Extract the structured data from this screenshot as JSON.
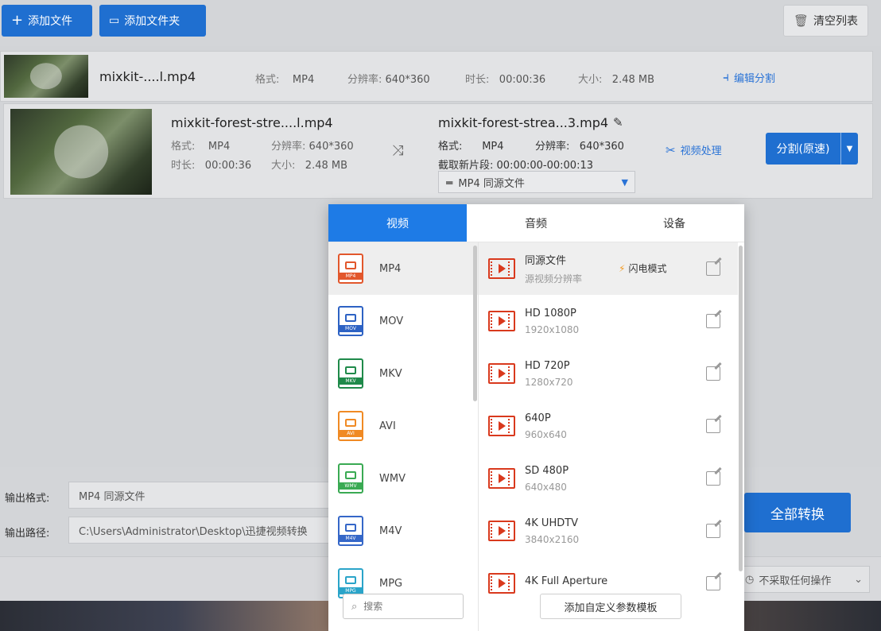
{
  "toolbar": {
    "add_file": "添加文件",
    "add_folder": "添加文件夹",
    "clear_list": "清空列表"
  },
  "file1": {
    "name": "mixkit-....l.mp4",
    "format_label": "格式:",
    "format": "MP4",
    "resolution_label": "分辨率:",
    "resolution": "640*360",
    "duration_label": "时长:",
    "duration": "00:00:36",
    "size_label": "大小:",
    "size": "2.48 MB",
    "edit_split": "编辑分割"
  },
  "file2": {
    "src_name": "mixkit-forest-stre....l.mp4",
    "format_label": "格式:",
    "format": "MP4",
    "resolution_label": "分辨率:",
    "resolution": "640*360",
    "duration_label": "时长:",
    "duration": "00:00:36",
    "size_label": "大小:",
    "size": "2.48 MB",
    "dst_name": "mixkit-forest-strea...3.mp4",
    "dst_format_label": "格式:",
    "dst_format": "MP4",
    "dst_resolution_label": "分辨率:",
    "dst_resolution": "640*360",
    "clip_label": "截取新片段:",
    "clip_range": "00:00:00-00:00:13",
    "format_select": "MP4  同源文件",
    "video_process": "视频处理",
    "split_button": "分割(原速)"
  },
  "popup": {
    "tabs": [
      "视频",
      "音频",
      "设备"
    ],
    "categories": [
      {
        "label": "MP4",
        "color": "#e2572c"
      },
      {
        "label": "MOV",
        "color": "#2d62c4"
      },
      {
        "label": "MKV",
        "color": "#1f8a4a"
      },
      {
        "label": "AVI",
        "color": "#f08a24"
      },
      {
        "label": "WMV",
        "color": "#3aaa53"
      },
      {
        "label": "M4V",
        "color": "#3567c8"
      },
      {
        "label": "MPG",
        "color": "#2aa4c9"
      }
    ],
    "presets": [
      {
        "name": "同源文件",
        "res": "源视频分辨率"
      },
      {
        "name": "HD 1080P",
        "res": "1920x1080"
      },
      {
        "name": "HD 720P",
        "res": "1280x720"
      },
      {
        "name": "640P",
        "res": "960x640"
      },
      {
        "name": "SD 480P",
        "res": "640x480"
      },
      {
        "name": "4K UHDTV",
        "res": "3840x2160"
      },
      {
        "name": "4K Full Aperture",
        "res": ""
      }
    ],
    "flash_mode": "闪电模式",
    "search_placeholder": "搜索",
    "add_template": "添加自定义参数模板"
  },
  "output": {
    "format_label": "输出格式:",
    "format_value": "MP4  同源文件",
    "path_label": "输出路径:",
    "path_value": "C:\\Users\\Administrator\\Desktop\\迅捷视频转换",
    "convert_all": "全部转换",
    "after_action": "不采取任何操作"
  }
}
